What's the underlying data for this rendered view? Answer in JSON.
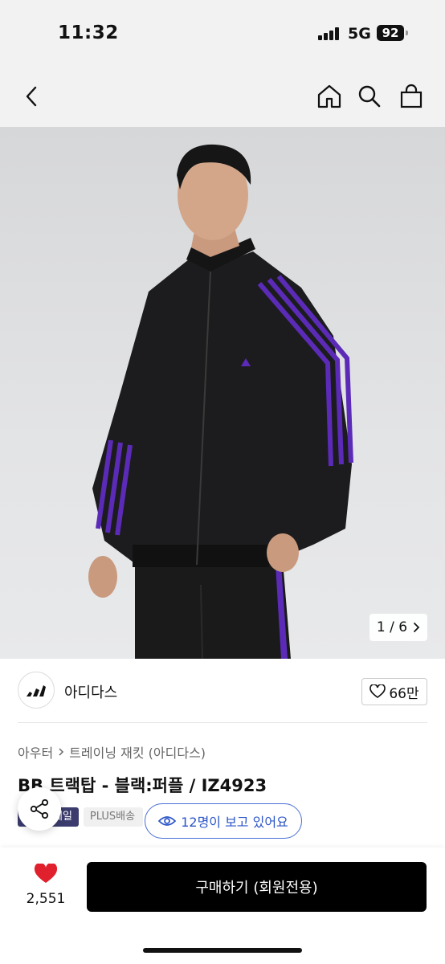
{
  "status_bar": {
    "time": "11:32",
    "network": "5G",
    "battery": "92"
  },
  "nav": {
    "back_icon": "chevron-left-icon",
    "home_icon": "home-icon",
    "search_icon": "search-icon",
    "bag_icon": "shopping-bag-icon"
  },
  "gallery": {
    "counter": "1 / 6"
  },
  "brand": {
    "name": "아디다스",
    "likes": "66만"
  },
  "breadcrumb": {
    "category": "아우터",
    "subcategory": "트레이닝 재킷 (아디다스)"
  },
  "product": {
    "title": "BB 트랙탑 - 블랙:퍼플 / IZ4923",
    "tag_sale": "세일",
    "tag_delivery": "PLUS배송"
  },
  "viewers": {
    "text": "12명이 보고 있어요"
  },
  "bottom": {
    "wish_count": "2,551",
    "buy_label": "구매하기 (회원전용)"
  },
  "colors": {
    "accent_blue": "#2b55c8",
    "heart_red": "#e0202c",
    "jacket_purple": "#5b2bb8"
  }
}
